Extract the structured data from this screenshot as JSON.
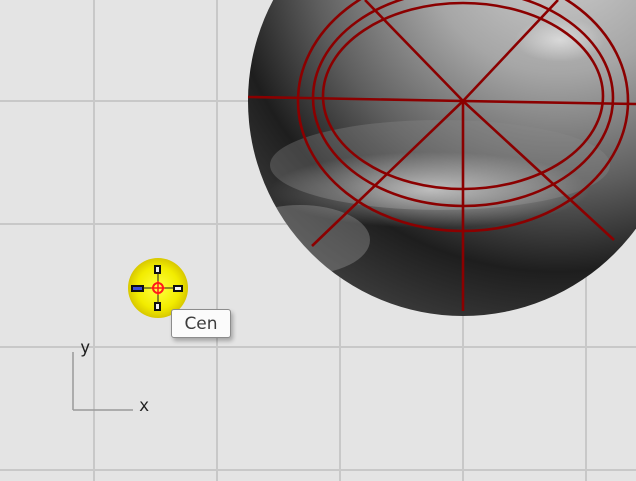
{
  "viewport": {
    "background": "#e4e4e4",
    "grid_color": "#c8c8c8",
    "object": "sphere",
    "isocurve_color": "#8b0000"
  },
  "osnap": {
    "marker_color": "#ffff00",
    "tooltip_label": "Cen"
  },
  "axis_widget": {
    "x_label": "x",
    "y_label": "y"
  }
}
